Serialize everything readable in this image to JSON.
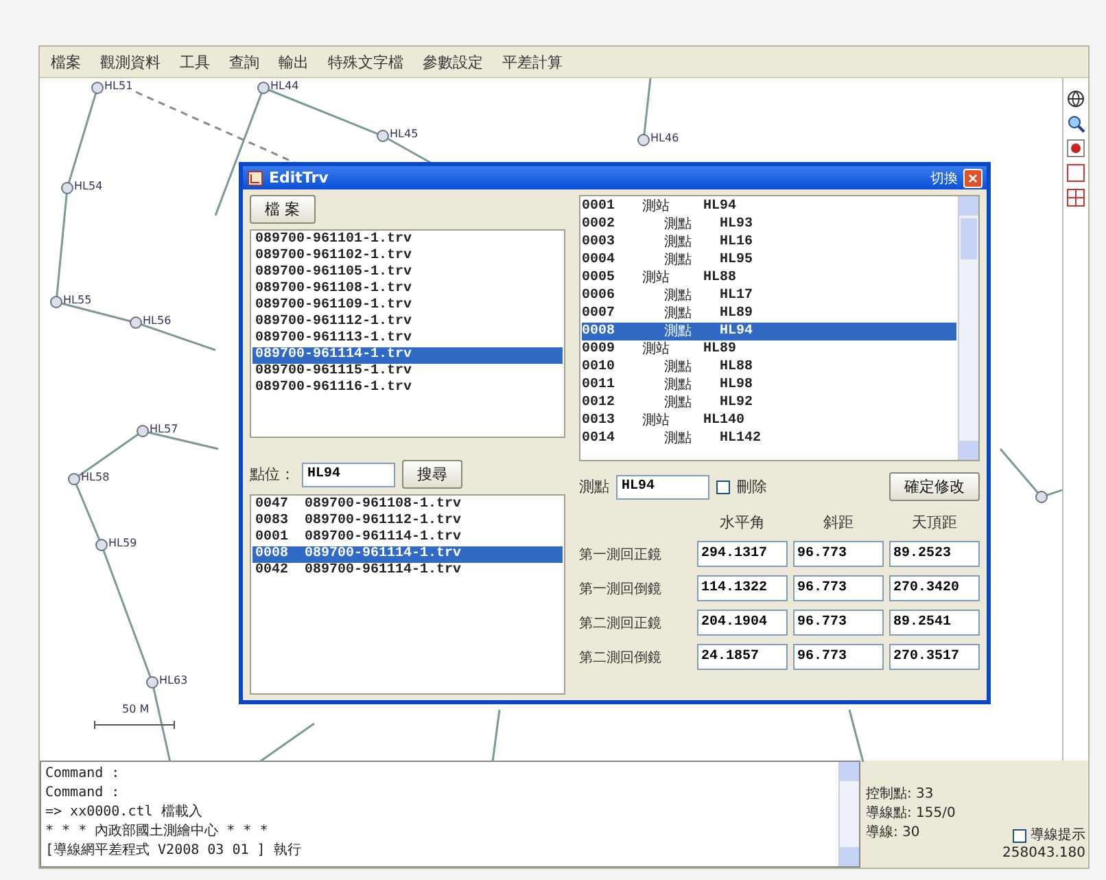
{
  "menu": [
    {
      "label": "檔案"
    },
    {
      "label": "觀測資料"
    },
    {
      "label": "工具"
    },
    {
      "label": "查詢"
    },
    {
      "label": "輸出"
    },
    {
      "label": "特殊文字檔"
    },
    {
      "label": "參數設定"
    },
    {
      "label": "平差計算"
    }
  ],
  "map": {
    "points": [
      "HL51",
      "HL44",
      "HL45",
      "HL46",
      "HL54",
      "HL55",
      "HL56",
      "HL57",
      "HL58",
      "HL59",
      "HL63"
    ],
    "scale_label": "50 M"
  },
  "dialog": {
    "title": "EditTrv",
    "title_button": "切換",
    "file_button": "檔 案",
    "files": [
      {
        "name": "089700-961101-1.trv",
        "selected": false
      },
      {
        "name": "089700-961102-1.trv",
        "selected": false
      },
      {
        "name": "089700-961105-1.trv",
        "selected": false
      },
      {
        "name": "089700-961108-1.trv",
        "selected": false
      },
      {
        "name": "089700-961109-1.trv",
        "selected": false
      },
      {
        "name": "089700-961112-1.trv",
        "selected": false
      },
      {
        "name": "089700-961113-1.trv",
        "selected": false
      },
      {
        "name": "089700-961114-1.trv",
        "selected": true
      },
      {
        "name": "089700-961115-1.trv",
        "selected": false
      },
      {
        "name": "089700-961116-1.trv",
        "selected": false
      }
    ],
    "search": {
      "label": "點位：",
      "value": "HL94",
      "button": "搜尋"
    },
    "results": [
      {
        "index": "0047",
        "file": "089700-961108-1.trv",
        "selected": false
      },
      {
        "index": "0083",
        "file": "089700-961112-1.trv",
        "selected": false
      },
      {
        "index": "0001",
        "file": "089700-961114-1.trv",
        "selected": false
      },
      {
        "index": "0008",
        "file": "089700-961114-1.trv",
        "selected": true
      },
      {
        "index": "0042",
        "file": "089700-961114-1.trv",
        "selected": false
      }
    ],
    "records": [
      {
        "index": "0001",
        "kind": "station",
        "label": "測站",
        "point": "HL94",
        "selected": false
      },
      {
        "index": "0002",
        "kind": "point",
        "label": "測點",
        "point": "HL93",
        "selected": false
      },
      {
        "index": "0003",
        "kind": "point",
        "label": "測點",
        "point": "HL16",
        "selected": false
      },
      {
        "index": "0004",
        "kind": "point",
        "label": "測點",
        "point": "HL95",
        "selected": false
      },
      {
        "index": "0005",
        "kind": "station",
        "label": "測站",
        "point": "HL88",
        "selected": false
      },
      {
        "index": "0006",
        "kind": "point",
        "label": "測點",
        "point": "HL17",
        "selected": false
      },
      {
        "index": "0007",
        "kind": "point",
        "label": "測點",
        "point": "HL89",
        "selected": false
      },
      {
        "index": "0008",
        "kind": "point",
        "label": "測點",
        "point": "HL94",
        "selected": true
      },
      {
        "index": "0009",
        "kind": "station",
        "label": "測站",
        "point": "HL89",
        "selected": false
      },
      {
        "index": "0010",
        "kind": "point",
        "label": "測點",
        "point": "HL88",
        "selected": false
      },
      {
        "index": "0011",
        "kind": "point",
        "label": "測點",
        "point": "HL98",
        "selected": false
      },
      {
        "index": "0012",
        "kind": "point",
        "label": "測點",
        "point": "HL92",
        "selected": false
      },
      {
        "index": "0013",
        "kind": "station",
        "label": "測站",
        "point": "HL140",
        "selected": false
      },
      {
        "index": "0014",
        "kind": "point",
        "label": "測點",
        "point": "HL142",
        "selected": false
      }
    ],
    "point": {
      "label": "測點",
      "value": "HL94"
    },
    "delete": {
      "label": "刪除",
      "checked": false
    },
    "confirm_button": "確定修改",
    "columns": [
      "水平角",
      "斜距",
      "天頂距"
    ],
    "observations": [
      {
        "label": "第一測回正鏡",
        "values": [
          "294.1317",
          "96.773",
          "89.2523"
        ]
      },
      {
        "label": "第一測回倒鏡",
        "values": [
          "114.1322",
          "96.773",
          "270.3420"
        ]
      },
      {
        "label": "第二測回正鏡",
        "values": [
          "204.1904",
          "96.773",
          "89.2541"
        ]
      },
      {
        "label": "第二測回倒鏡",
        "values": [
          "24.1857",
          "96.773",
          "270.3517"
        ]
      }
    ]
  },
  "console": {
    "lines": [
      "Command :",
      "Command :",
      "=> xx0000.ctl 檔載入",
      "* * * 內政部國土測繪中心 * * *",
      "[導線網平差程式 V2008 03 01 ] 執行"
    ]
  },
  "status": {
    "items": [
      "控制點: 33",
      "導線點: 155/0",
      "導線: 30"
    ],
    "hint": {
      "label": "導線提示",
      "checked": false
    },
    "coordinate": "258043.180"
  }
}
